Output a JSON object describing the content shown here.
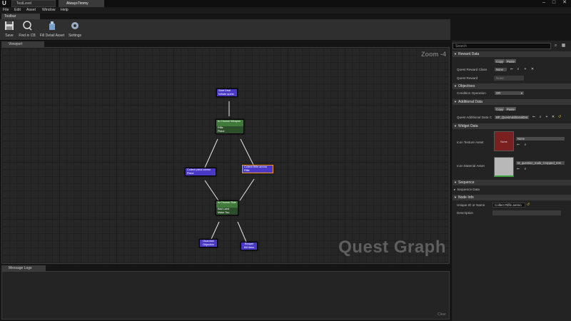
{
  "window": {
    "tabs": [
      "TestLevel",
      "AlwaysTimmy"
    ],
    "controls": [
      "–",
      "□",
      "✕"
    ]
  },
  "menu": [
    "File",
    "Edit",
    "Asset",
    "Window",
    "Help"
  ],
  "toolbar": {
    "tab_label": "Toolbar",
    "buttons": [
      {
        "label": "Save",
        "icon": "save-icon"
      },
      {
        "label": "Find in CB",
        "icon": "find-in-content-browser-icon"
      },
      {
        "label": "Fill Detail Asset",
        "icon": "fill-detail-asset-icon"
      },
      {
        "label": "Settings",
        "icon": "settings-icon"
      }
    ]
  },
  "viewport": {
    "tab_label": "Viewport",
    "zoom": "Zoom -4",
    "watermark": "Quest Graph",
    "nodes": {
      "start": [
        "Start Deal",
        "Initiate quest"
      ],
      "choose_weapon": [
        "Is Choose Weapon",
        "Rifle",
        "Pistol"
      ],
      "collect_pistol": [
        "Collect pistol ammo",
        "Pistol"
      ],
      "collect_rifle": [
        "Collect Rifle ammo",
        "Rifle"
      ],
      "choose_side": [
        "Is Choose Side",
        "Bad Land",
        "Make Too"
      ],
      "guardian": [
        "Guardian",
        "Objective"
      ],
      "reaper": [
        "Reaper",
        "Kill them"
      ]
    }
  },
  "message_log": {
    "tab_label": "Message Logs",
    "clear_label": "Clear"
  },
  "details": {
    "search_placeholder": "Search",
    "sections": {
      "reward": "Reward Data",
      "objectives": "Objectives",
      "additional": "Additional Data",
      "widget": "Widget Data",
      "sequence": "Sequence",
      "node_info": "Node Info"
    },
    "copy_label": "Copy",
    "paste_label": "Paste",
    "quest_reward_class_label": "Quest Reward Class",
    "quest_reward_class_value": "None",
    "quest_reward_label": "Quest Reward",
    "quest_reward_value": "None",
    "condition_operation_label": "Condition Operation",
    "condition_operation_value": "OR",
    "quest_additional_data_label": "Quest Additional Data C",
    "quest_additional_data_value": "BP_QuestAdditionalDat",
    "icon_texture_label": "Icon Texture Asset",
    "icon_texture_thumb": "None",
    "icon_texture_value": "None",
    "icon_material_label": "Icon Material Asset",
    "icon_material_value": "M_question_mark_Cropped_Inst",
    "sequence_data_label": "Sequence Data",
    "unique_id_label": "Unique ID or Name",
    "unique_id_value": "Collect Rifle ammo",
    "description_label": "Description",
    "description_value": ""
  },
  "colors": {
    "node_blue": "#4a39c4",
    "node_green": "#3f7a3a",
    "selection": "#ff9a1a"
  }
}
